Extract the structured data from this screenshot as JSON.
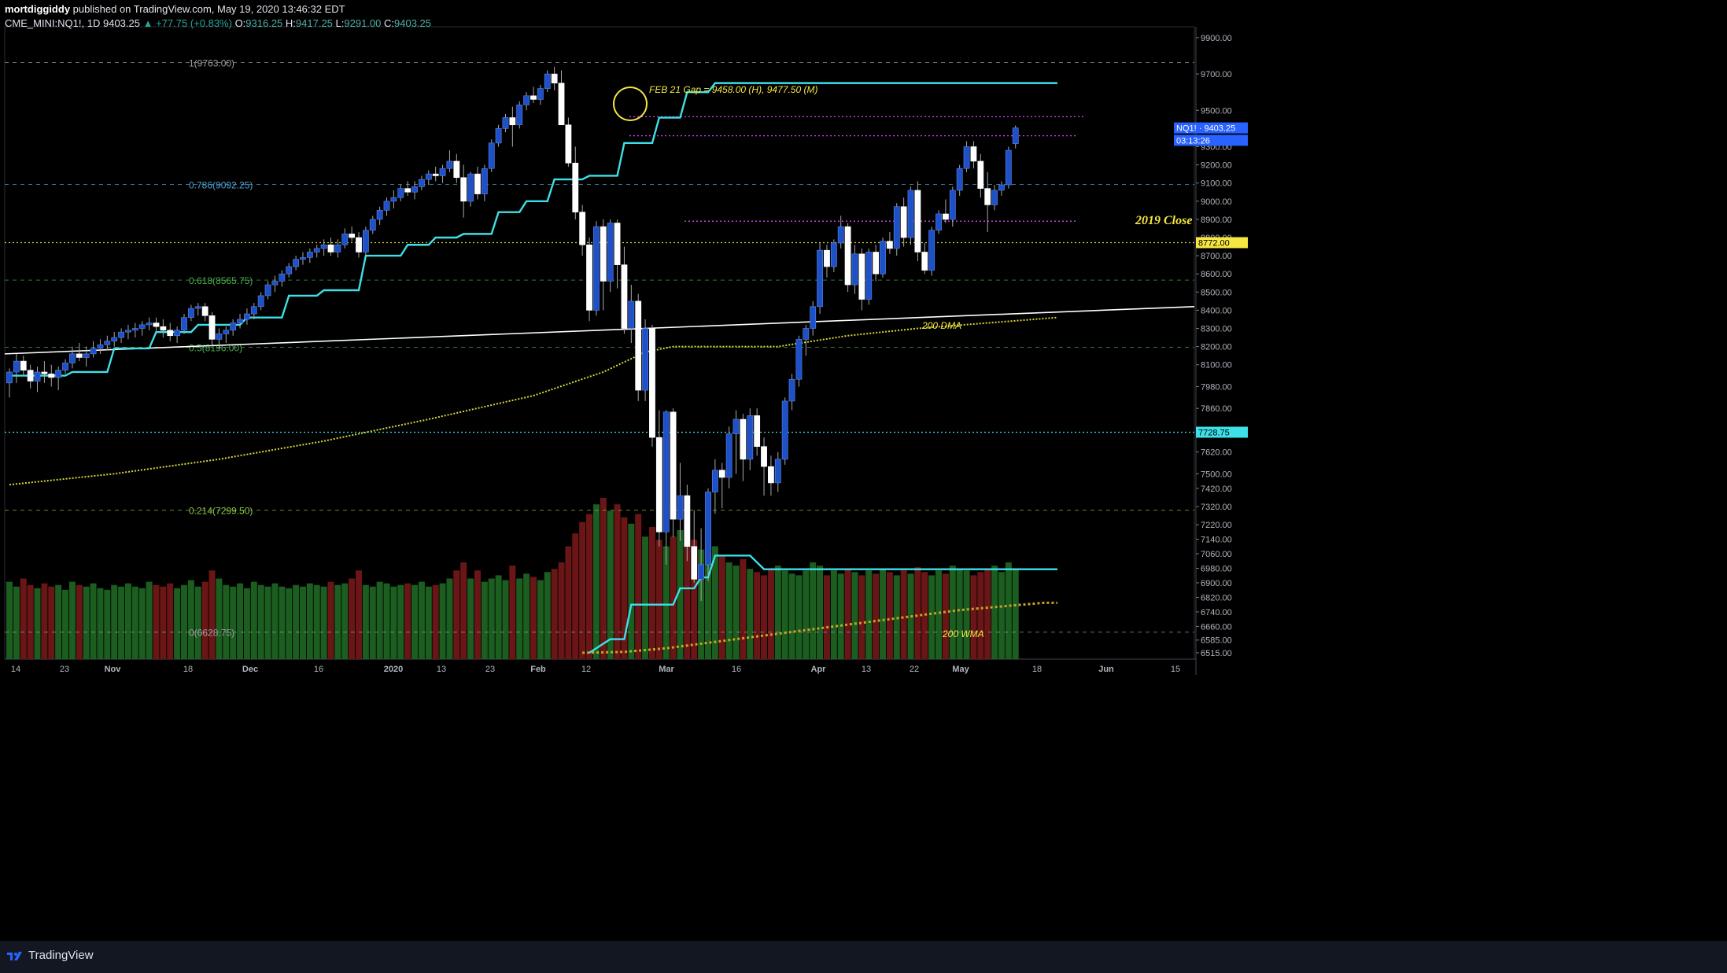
{
  "header": {
    "author": "mortdiggiddy",
    "published_text": "published on TradingView.com, May 19, 2020 13:46:32 EDT",
    "symbol": "CME_MINI:NQ1!, 1D",
    "last": "9403.25",
    "change": "▲ +77.75 (+0.83%)",
    "o_label": "O:",
    "o_value": "9316.25",
    "h_label": "H:",
    "h_value": "9417.25",
    "l_label": "L:",
    "l_value": "9291.00",
    "c_label": "C:",
    "c_value": "9403.25"
  },
  "footer": {
    "brand": "TradingView"
  },
  "colors": {
    "background": "#000000",
    "bull_candle": "#1e50c8",
    "bear_candle": "#ffffff",
    "volume_up": "#1b5e20",
    "volume_down": "#6b1616",
    "stop_line": "#3ee0e8",
    "dma": "#d7d73c",
    "fib_label": "#4fa0d0"
  },
  "chart_data": {
    "type": "candlestick",
    "timeframe": "1D",
    "ylim": [
      6480,
      9960
    ],
    "y_ticks": [
      9900,
      9700,
      9500,
      9300,
      9200,
      9100,
      9000,
      8900,
      8800,
      8700,
      8600,
      8500,
      8400,
      8300,
      8200,
      8100,
      7980,
      7860,
      7740,
      7620,
      7500,
      7420,
      7320,
      7220,
      7140,
      7060,
      6980,
      6900,
      6820,
      6740,
      6660,
      6585,
      6515
    ],
    "y_tick_labels": [
      "9900.00",
      "9700.00",
      "9500.00",
      "9300.00",
      "9200.00",
      "9100.00",
      "9000.00",
      "8900.00",
      "8800.00",
      "8700.00",
      "8600.00",
      "8500.00",
      "8400.00",
      "8300.00",
      "8200.00",
      "8100.00",
      "7980.00",
      "7860.00",
      "7740.00",
      "7620.00",
      "7500.00",
      "7420.00",
      "7320.00",
      "7220.00",
      "7140.00",
      "7060.00",
      "6980.00",
      "6900.00",
      "6820.00",
      "6740.00",
      "6660.00",
      "6585.00",
      "6515.00"
    ],
    "x_labels": [
      "14",
      "23",
      "Nov",
      "18",
      "Dec",
      "16",
      "2020",
      "13",
      "23",
      "Feb",
      "12",
      "Mar",
      "16",
      "Apr",
      "13",
      "22",
      "May",
      "18",
      "Jun",
      "15"
    ],
    "price_labels": [
      {
        "text": "NQ1! · 9403.25",
        "value": 9403.25,
        "color": "#2962ff"
      },
      {
        "text": "03:13:26",
        "value": 9335,
        "color": "#2962ff"
      },
      {
        "text": "8772.00",
        "value": 8772,
        "color": "#f5e642"
      },
      {
        "text": "7728.75",
        "value": 7728.75,
        "color": "#3ee0e8"
      }
    ],
    "fib_levels": [
      {
        "ratio": "1",
        "value": 9763,
        "label": "1(9763.00)",
        "color": "#9e9e9e"
      },
      {
        "ratio": "0.786",
        "value": 9092.25,
        "label": "0.786(9092.25)",
        "color": "#4fa0d0"
      },
      {
        "ratio": "0.618",
        "value": 8565.75,
        "label": "0.618(8565.75)",
        "color": "#4caf50"
      },
      {
        "ratio": "0.5",
        "value": 8196,
        "label": "0.5(8196.00)",
        "color": "#4caf50"
      },
      {
        "ratio": "0.214",
        "value": 7299.5,
        "label": "0.214(7299.50)",
        "color": "#8bc34a"
      },
      {
        "ratio": "0",
        "value": 6628.75,
        "label": "0(6628.75)",
        "color": "#9e9e9e"
      }
    ],
    "annotations": [
      {
        "text": "FEB 21 Gap = 9458.00 (H), 9477.50 (M)",
        "color": "#f5e642"
      },
      {
        "text": "2019 Close",
        "color": "#f5e642"
      },
      {
        "text": "200 DMA",
        "color": "#f5e642"
      },
      {
        "text": "200 WMA",
        "color": "#f5e642"
      }
    ],
    "levels": {
      "gap_high": 9477.5,
      "gap_low": 9458.0,
      "magenta_upper": 9465,
      "magenta_mid": 9360,
      "magenta_low": 8890,
      "close_2019": 8772,
      "horizontal_dotted": 7728.75,
      "stop_upper": 9650,
      "stop_lower": 6975
    },
    "ohlc": [
      [
        8000,
        8080,
        7920,
        8060
      ],
      [
        8060,
        8160,
        8000,
        8120
      ],
      [
        8120,
        8150,
        8040,
        8070
      ],
      [
        8070,
        8100,
        7970,
        8010
      ],
      [
        8010,
        8090,
        7950,
        8060
      ],
      [
        8060,
        8120,
        8000,
        8050
      ],
      [
        8050,
        8100,
        7980,
        8030
      ],
      [
        8030,
        8090,
        7960,
        8070
      ],
      [
        8070,
        8130,
        8050,
        8110
      ],
      [
        8110,
        8200,
        8080,
        8160
      ],
      [
        8160,
        8220,
        8120,
        8140
      ],
      [
        8140,
        8200,
        8090,
        8160
      ],
      [
        8160,
        8230,
        8140,
        8190
      ],
      [
        8190,
        8240,
        8160,
        8210
      ],
      [
        8210,
        8260,
        8180,
        8230
      ],
      [
        8230,
        8280,
        8200,
        8250
      ],
      [
        8250,
        8300,
        8220,
        8280
      ],
      [
        8280,
        8320,
        8240,
        8290
      ],
      [
        8290,
        8330,
        8250,
        8300
      ],
      [
        8300,
        8340,
        8260,
        8320
      ],
      [
        8320,
        8360,
        8290,
        8330
      ],
      [
        8330,
        8360,
        8280,
        8310
      ],
      [
        8310,
        8350,
        8250,
        8290
      ],
      [
        8290,
        8330,
        8230,
        8260
      ],
      [
        8260,
        8310,
        8220,
        8290
      ],
      [
        8290,
        8380,
        8270,
        8360
      ],
      [
        8360,
        8430,
        8340,
        8410
      ],
      [
        8410,
        8440,
        8370,
        8420
      ],
      [
        8420,
        8440,
        8340,
        8370
      ],
      [
        8370,
        8390,
        8210,
        8240
      ],
      [
        8240,
        8300,
        8190,
        8270
      ],
      [
        8270,
        8310,
        8220,
        8290
      ],
      [
        8290,
        8350,
        8260,
        8330
      ],
      [
        8330,
        8380,
        8300,
        8350
      ],
      [
        8350,
        8410,
        8320,
        8380
      ],
      [
        8380,
        8440,
        8350,
        8420
      ],
      [
        8420,
        8500,
        8400,
        8480
      ],
      [
        8480,
        8560,
        8460,
        8540
      ],
      [
        8540,
        8590,
        8500,
        8560
      ],
      [
        8560,
        8620,
        8530,
        8600
      ],
      [
        8600,
        8660,
        8580,
        8640
      ],
      [
        8640,
        8700,
        8620,
        8680
      ],
      [
        8680,
        8720,
        8650,
        8690
      ],
      [
        8690,
        8740,
        8660,
        8720
      ],
      [
        8720,
        8760,
        8690,
        8740
      ],
      [
        8740,
        8790,
        8700,
        8760
      ],
      [
        8760,
        8800,
        8700,
        8720
      ],
      [
        8720,
        8790,
        8690,
        8760
      ],
      [
        8760,
        8850,
        8740,
        8820
      ],
      [
        8820,
        8860,
        8780,
        8800
      ],
      [
        8800,
        8830,
        8690,
        8720
      ],
      [
        8720,
        8860,
        8700,
        8840
      ],
      [
        8840,
        8920,
        8820,
        8900
      ],
      [
        8900,
        8970,
        8870,
        8950
      ],
      [
        8950,
        9020,
        8920,
        9000
      ],
      [
        9000,
        9060,
        8960,
        9020
      ],
      [
        9020,
        9090,
        9000,
        9070
      ],
      [
        9070,
        9110,
        9030,
        9050
      ],
      [
        9050,
        9110,
        9010,
        9080
      ],
      [
        9080,
        9140,
        9060,
        9120
      ],
      [
        9120,
        9170,
        9090,
        9150
      ],
      [
        9150,
        9190,
        9110,
        9140
      ],
      [
        9140,
        9200,
        9100,
        9180
      ],
      [
        9180,
        9280,
        9160,
        9220
      ],
      [
        9220,
        9260,
        9100,
        9130
      ],
      [
        9130,
        9200,
        8910,
        9000
      ],
      [
        9000,
        9160,
        8970,
        9150
      ],
      [
        9150,
        9190,
        9010,
        9040
      ],
      [
        9040,
        9200,
        9000,
        9180
      ],
      [
        9180,
        9340,
        9160,
        9320
      ],
      [
        9320,
        9420,
        9300,
        9400
      ],
      [
        9400,
        9480,
        9380,
        9460
      ],
      [
        9460,
        9520,
        9300,
        9420
      ],
      [
        9420,
        9550,
        9400,
        9530
      ],
      [
        9530,
        9600,
        9500,
        9580
      ],
      [
        9580,
        9630,
        9540,
        9560
      ],
      [
        9560,
        9640,
        9530,
        9620
      ],
      [
        9620,
        9720,
        9600,
        9700
      ],
      [
        9700,
        9740,
        9610,
        9650
      ],
      [
        9650,
        9720,
        9420,
        9420
      ],
      [
        9420,
        9460,
        9190,
        9210
      ],
      [
        9210,
        9300,
        8900,
        8940
      ],
      [
        8940,
        8980,
        8700,
        8760
      ],
      [
        8760,
        8800,
        8340,
        8400
      ],
      [
        8400,
        8890,
        8370,
        8860
      ],
      [
        8860,
        8900,
        8400,
        8560
      ],
      [
        8560,
        8900,
        8500,
        8880
      ],
      [
        8880,
        8900,
        8520,
        8650
      ],
      [
        8650,
        8750,
        8270,
        8300
      ],
      [
        8300,
        8540,
        8220,
        8450
      ],
      [
        8450,
        8490,
        7900,
        7960
      ],
      [
        7960,
        8350,
        7900,
        8300
      ],
      [
        8300,
        8320,
        7650,
        7700
      ],
      [
        7700,
        7850,
        7100,
        7180
      ],
      [
        7180,
        7850,
        7000,
        7840
      ],
      [
        7840,
        7860,
        7150,
        7250
      ],
      [
        7250,
        7560,
        7130,
        7380
      ],
      [
        7380,
        7440,
        7020,
        7100
      ],
      [
        7100,
        7300,
        6900,
        6920
      ],
      [
        6920,
        7200,
        6800,
        7000
      ],
      [
        7000,
        7420,
        6910,
        7400
      ],
      [
        7400,
        7580,
        7280,
        7520
      ],
      [
        7520,
        7560,
        7310,
        7480
      ],
      [
        7480,
        7760,
        7420,
        7720
      ],
      [
        7720,
        7850,
        7500,
        7800
      ],
      [
        7800,
        7830,
        7460,
        7580
      ],
      [
        7580,
        7860,
        7520,
        7820
      ],
      [
        7820,
        7860,
        7600,
        7650
      ],
      [
        7650,
        7700,
        7380,
        7540
      ],
      [
        7540,
        7600,
        7380,
        7450
      ],
      [
        7450,
        7620,
        7400,
        7580
      ],
      [
        7580,
        7920,
        7550,
        7900
      ],
      [
        7900,
        8050,
        7850,
        8020
      ],
      [
        8020,
        8260,
        7980,
        8240
      ],
      [
        8240,
        8320,
        8150,
        8300
      ],
      [
        8300,
        8450,
        8260,
        8420
      ],
      [
        8420,
        8770,
        8380,
        8730
      ],
      [
        8730,
        8760,
        8580,
        8640
      ],
      [
        8640,
        8790,
        8610,
        8770
      ],
      [
        8770,
        8920,
        8740,
        8860
      ],
      [
        8860,
        8880,
        8500,
        8540
      ],
      [
        8540,
        8760,
        8490,
        8710
      ],
      [
        8710,
        8740,
        8400,
        8460
      ],
      [
        8460,
        8740,
        8430,
        8720
      ],
      [
        8720,
        8760,
        8560,
        8600
      ],
      [
        8600,
        8800,
        8580,
        8780
      ],
      [
        8780,
        8830,
        8710,
        8740
      ],
      [
        8740,
        8990,
        8700,
        8970
      ],
      [
        8970,
        9020,
        8750,
        8800
      ],
      [
        8800,
        9080,
        8760,
        9060
      ],
      [
        9060,
        9110,
        8670,
        8720
      ],
      [
        8720,
        8770,
        8600,
        8620
      ],
      [
        8620,
        8860,
        8590,
        8840
      ],
      [
        8840,
        8950,
        8820,
        8930
      ],
      [
        8930,
        9010,
        8880,
        8900
      ],
      [
        8900,
        9080,
        8860,
        9060
      ],
      [
        9060,
        9200,
        9030,
        9180
      ],
      [
        9180,
        9330,
        9160,
        9300
      ],
      [
        9300,
        9330,
        9180,
        9220
      ],
      [
        9220,
        9260,
        9020,
        9070
      ],
      [
        9070,
        9160,
        8830,
        8980
      ],
      [
        8980,
        9090,
        8950,
        9060
      ],
      [
        9060,
        9110,
        9030,
        9090
      ],
      [
        9090,
        9300,
        9070,
        9280
      ],
      [
        9316.25,
        9417.25,
        9291,
        9403.25
      ]
    ],
    "volume": [
      0.48,
      0.45,
      0.5,
      0.46,
      0.44,
      0.47,
      0.45,
      0.46,
      0.43,
      0.48,
      0.46,
      0.45,
      0.47,
      0.44,
      0.43,
      0.46,
      0.45,
      0.47,
      0.45,
      0.44,
      0.48,
      0.46,
      0.45,
      0.47,
      0.44,
      0.46,
      0.49,
      0.45,
      0.48,
      0.55,
      0.5,
      0.46,
      0.45,
      0.47,
      0.44,
      0.48,
      0.46,
      0.45,
      0.47,
      0.45,
      0.44,
      0.46,
      0.45,
      0.47,
      0.46,
      0.45,
      0.48,
      0.46,
      0.47,
      0.5,
      0.55,
      0.46,
      0.45,
      0.48,
      0.47,
      0.45,
      0.46,
      0.47,
      0.46,
      0.48,
      0.45,
      0.46,
      0.47,
      0.5,
      0.55,
      0.6,
      0.5,
      0.55,
      0.48,
      0.5,
      0.52,
      0.49,
      0.58,
      0.5,
      0.53,
      0.51,
      0.49,
      0.54,
      0.56,
      0.6,
      0.7,
      0.78,
      0.85,
      0.9,
      0.96,
      1.0,
      0.92,
      0.96,
      0.88,
      0.84,
      0.9,
      0.76,
      0.82,
      0.74,
      0.7,
      0.76,
      0.8,
      0.72,
      0.74,
      0.68,
      0.62,
      0.7,
      0.64,
      0.6,
      0.58,
      0.62,
      0.56,
      0.54,
      0.52,
      0.56,
      0.58,
      0.55,
      0.53,
      0.52,
      0.55,
      0.6,
      0.58,
      0.52,
      0.55,
      0.53,
      0.56,
      0.54,
      0.52,
      0.55,
      0.53,
      0.56,
      0.54,
      0.52,
      0.55,
      0.53,
      0.57,
      0.54,
      0.52,
      0.55,
      0.53,
      0.58,
      0.56,
      0.55,
      0.52,
      0.54,
      0.56,
      0.58,
      0.54,
      0.6,
      0.56
    ],
    "stop_line": [
      [
        0,
        8040
      ],
      [
        8,
        8040
      ],
      [
        9,
        8060
      ],
      [
        14,
        8060
      ],
      [
        15,
        8190
      ],
      [
        20,
        8190
      ],
      [
        21,
        8280
      ],
      [
        26,
        8280
      ],
      [
        27,
        8320
      ],
      [
        33,
        8320
      ],
      [
        34,
        8360
      ],
      [
        39,
        8360
      ],
      [
        40,
        8480
      ],
      [
        44,
        8480
      ],
      [
        45,
        8510
      ],
      [
        50,
        8510
      ],
      [
        51,
        8700
      ],
      [
        56,
        8700
      ],
      [
        57,
        8760
      ],
      [
        60,
        8760
      ],
      [
        61,
        8800
      ],
      [
        64,
        8800
      ],
      [
        65,
        8820
      ],
      [
        69,
        8820
      ],
      [
        70,
        8940
      ],
      [
        73,
        8940
      ],
      [
        74,
        9000
      ],
      [
        77,
        9000
      ],
      [
        78,
        9120
      ],
      [
        82,
        9120
      ],
      [
        83,
        9140
      ],
      [
        87,
        9140
      ],
      [
        88,
        9320
      ],
      [
        92,
        9320
      ],
      [
        93,
        9460
      ],
      [
        96,
        9460
      ],
      [
        97,
        9600
      ],
      [
        100,
        9600
      ],
      [
        101,
        9650
      ],
      [
        150,
        9650
      ]
    ],
    "stop_line_lower": [
      [
        83,
        6515
      ],
      [
        86,
        6590
      ],
      [
        88,
        6590
      ],
      [
        89,
        6780
      ],
      [
        95,
        6780
      ],
      [
        96,
        6870
      ],
      [
        98,
        6870
      ],
      [
        99,
        6930
      ],
      [
        100,
        6930
      ],
      [
        101,
        7050
      ],
      [
        104,
        7050
      ],
      [
        106,
        7050
      ],
      [
        108,
        6975
      ],
      [
        150,
        6975
      ]
    ],
    "dma": [
      [
        0,
        7440
      ],
      [
        15,
        7500
      ],
      [
        30,
        7580
      ],
      [
        45,
        7680
      ],
      [
        60,
        7800
      ],
      [
        75,
        7930
      ],
      [
        85,
        8060
      ],
      [
        91,
        8170
      ],
      [
        95,
        8200
      ],
      [
        110,
        8200
      ],
      [
        120,
        8260
      ],
      [
        130,
        8300
      ],
      [
        150,
        8360
      ]
    ],
    "wma": [
      [
        82,
        6515
      ],
      [
        88,
        6520
      ],
      [
        94,
        6540
      ],
      [
        100,
        6570
      ],
      [
        106,
        6600
      ],
      [
        112,
        6630
      ],
      [
        118,
        6660
      ],
      [
        124,
        6690
      ],
      [
        130,
        6720
      ],
      [
        136,
        6750
      ],
      [
        142,
        6770
      ],
      [
        148,
        6790
      ],
      [
        150,
        6790
      ]
    ]
  }
}
